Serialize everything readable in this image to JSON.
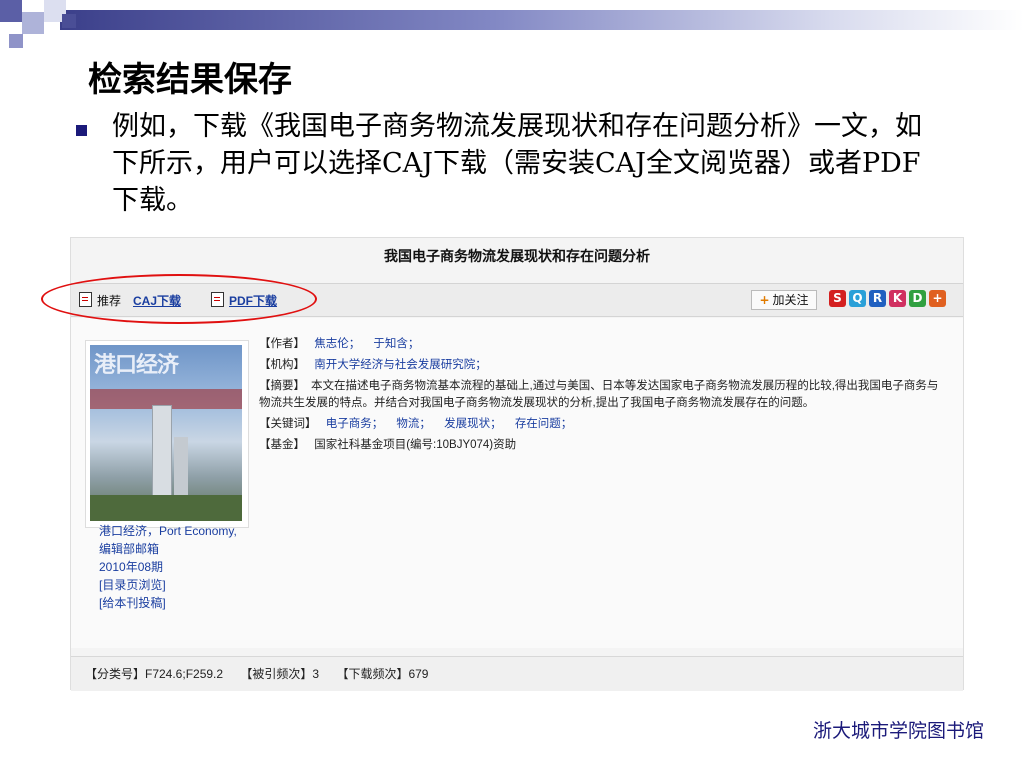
{
  "slide": {
    "title": "检索结果保存",
    "bullet": "例如，下载《我国电子商务物流发展现状和存在问题分析》一文，如下所示，用户可以选择CAJ下载（需安装CAJ全文阅览器）或者PDF下载。",
    "credit": "浙大城市学院图书馆"
  },
  "screenshot": {
    "article_title": "我国电子商务物流发展现状和存在问题分析",
    "toolbar": {
      "recommend": "推荐",
      "caj_download": "CAJ下载",
      "pdf_download": "PDF下载",
      "follow": "加关注"
    },
    "cover": {
      "title": "港口经济"
    },
    "side_links": {
      "journal": "港口经济，Port Economy,",
      "editor": "编辑部邮箱",
      "issue": "2010年08期",
      "toc": "[目录页浏览]",
      "submit": "[给本刊投稿]"
    },
    "meta": {
      "author_label": "【作者】",
      "authors": [
        "焦志伦；",
        "于知含；"
      ],
      "org_label": "【机构】",
      "org": "南开大学经济与社会发展研究院；",
      "abstract_label": "【摘要】",
      "abstract": "本文在描述电子商务物流基本流程的基础上,通过与美国、日本等发达国家电子商务物流发展历程的比较,得出我国电子商务与物流共生发展的特点。并结合对我国电子商务物流发展现状的分析,提出了我国电子商务物流发展存在的问题。",
      "keywords_label": "【关键词】",
      "keywords": [
        "电子商务；",
        "物流；",
        "发展现状；",
        "存在问题；"
      ],
      "fund_label": "【基金】",
      "fund": "国家社科基金项目(编号:10BJY074)资助"
    },
    "footer": {
      "class_no": "【分类号】F724.6;F259.2",
      "cited": "【被引频次】3",
      "downloads": "【下载频次】679"
    }
  },
  "colors": {
    "accent": "#1b1a7a",
    "link": "#1a3ea0",
    "annotation": "#e01010"
  }
}
